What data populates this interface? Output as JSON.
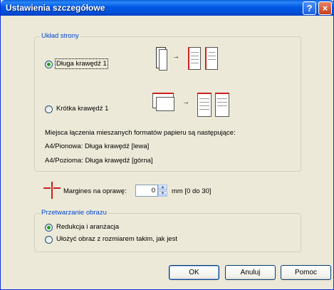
{
  "window": {
    "title": "Ustawienia szczegółowe",
    "help_glyph": "?",
    "close_glyph": "×"
  },
  "layout_group": {
    "legend": "Układ strony",
    "options": [
      {
        "label": "Długa krawędź 1",
        "checked": true
      },
      {
        "label": "Krótka krawędź 1",
        "checked": false
      }
    ],
    "info_heading": "Miejsca łączenia mieszanych formatów papieru są następujące:",
    "info_line1": "A4/Pionowa: Długa krawędź [lewa]",
    "info_line2": "A4/Pozioma: Długa krawędź [górna]"
  },
  "margin": {
    "label": "Margines na oprawę:",
    "value": "0",
    "range": "mm [0 do 30]"
  },
  "image_group": {
    "legend": "Przetwarzanie obrazu",
    "options": [
      {
        "label": "Redukcja i aranżacja",
        "checked": true
      },
      {
        "label": "Ułożyć obraz z rozmiarem takim, jak jest",
        "checked": false
      }
    ]
  },
  "buttons": {
    "ok": "OK",
    "cancel": "Anuluj",
    "help": "Pomoc"
  },
  "colors": {
    "title_bar": "#0054e3",
    "legend_text": "#0046d5",
    "radio_dot": "#21a121",
    "dialog_bg": "#ece9d8"
  },
  "icons": {
    "arrow": "→",
    "spin_up": "▲",
    "spin_down": "▼"
  }
}
